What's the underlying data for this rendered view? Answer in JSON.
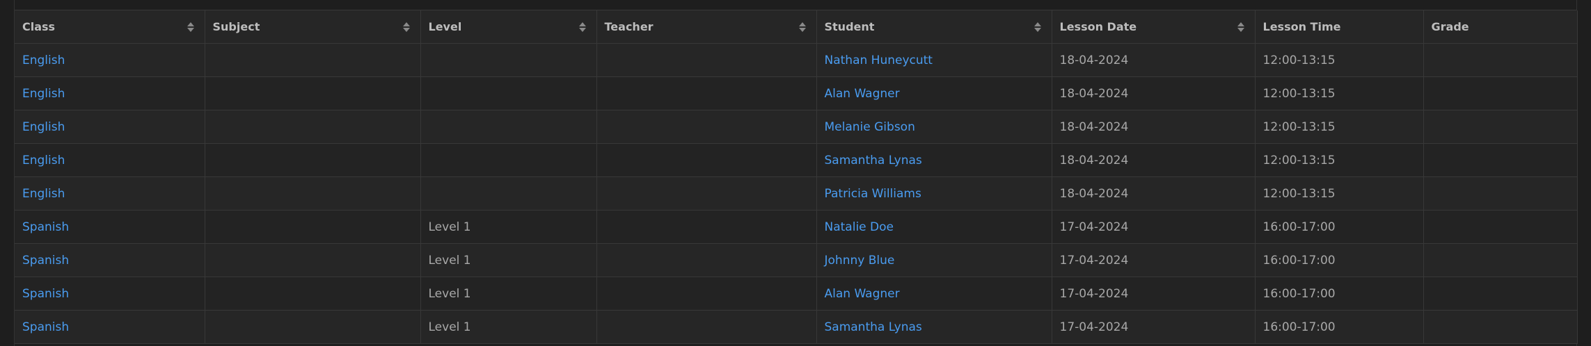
{
  "table": {
    "columns": [
      {
        "label": "Class",
        "sortable": true
      },
      {
        "label": "Subject",
        "sortable": true
      },
      {
        "label": "Level",
        "sortable": true
      },
      {
        "label": "Teacher",
        "sortable": true
      },
      {
        "label": "Student",
        "sortable": true
      },
      {
        "label": "Lesson Date",
        "sortable": true
      },
      {
        "label": "Lesson Time",
        "sortable": false
      },
      {
        "label": "Grade",
        "sortable": false
      }
    ],
    "rows": [
      {
        "class": "English",
        "subject": "",
        "level": "",
        "teacher": "",
        "student": "Nathan Huneycutt",
        "date": "18-04-2024",
        "time": "12:00-13:15",
        "grade": ""
      },
      {
        "class": "English",
        "subject": "",
        "level": "",
        "teacher": "",
        "student": "Alan Wagner",
        "date": "18-04-2024",
        "time": "12:00-13:15",
        "grade": ""
      },
      {
        "class": "English",
        "subject": "",
        "level": "",
        "teacher": "",
        "student": "Melanie Gibson",
        "date": "18-04-2024",
        "time": "12:00-13:15",
        "grade": ""
      },
      {
        "class": "English",
        "subject": "",
        "level": "",
        "teacher": "",
        "student": "Samantha Lynas",
        "date": "18-04-2024",
        "time": "12:00-13:15",
        "grade": ""
      },
      {
        "class": "English",
        "subject": "",
        "level": "",
        "teacher": "",
        "student": "Patricia Williams",
        "date": "18-04-2024",
        "time": "12:00-13:15",
        "grade": ""
      },
      {
        "class": "Spanish",
        "subject": "",
        "level": "Level 1",
        "teacher": "",
        "student": "Natalie Doe",
        "date": "17-04-2024",
        "time": "16:00-17:00",
        "grade": ""
      },
      {
        "class": "Spanish",
        "subject": "",
        "level": "Level 1",
        "teacher": "",
        "student": "Johnny Blue",
        "date": "17-04-2024",
        "time": "16:00-17:00",
        "grade": ""
      },
      {
        "class": "Spanish",
        "subject": "",
        "level": "Level 1",
        "teacher": "",
        "student": "Alan Wagner",
        "date": "17-04-2024",
        "time": "16:00-17:00",
        "grade": ""
      },
      {
        "class": "Spanish",
        "subject": "",
        "level": "Level 1",
        "teacher": "",
        "student": "Samantha Lynas",
        "date": "17-04-2024",
        "time": "16:00-17:00",
        "grade": ""
      }
    ]
  },
  "colors": {
    "background": "#1e1e1e",
    "cell": "#262626",
    "link": "#4a9cf0",
    "text": "#a8a8a8",
    "header_text": "#bdbdbd",
    "border": "#383838"
  },
  "icons": {
    "sort": "sort-icon"
  }
}
